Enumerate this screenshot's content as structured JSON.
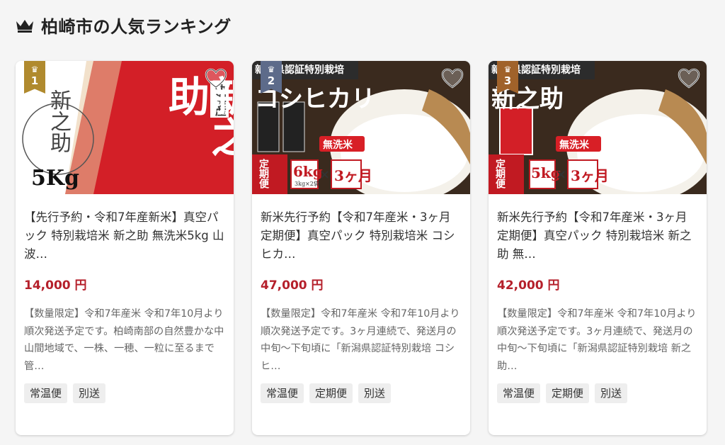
{
  "header": {
    "title": "柏崎市の人気ランキング",
    "icon": "crown-icon"
  },
  "colors": {
    "price": "#b5202b",
    "rank_badge": "#b08a2e",
    "tag_bg": "#eeeeee"
  },
  "cards": [
    {
      "rank": "1",
      "image_text": {
        "brand": "新之助",
        "weight": "5Kg",
        "seal": "新之助",
        "label": "新潟産"
      },
      "title": "【先行予約・令和7年産新米】真空パック 特別栽培米 新之助 無洗米5kg 山波…",
      "price": "14,000 円",
      "description": "【数量限定】令和7年産米 令和7年10月より順次発送予定です。柏崎南部の自然豊かな中山間地域で、一株、一穂、一粒に至るまで管…",
      "tags": [
        "常温便",
        "別送"
      ]
    },
    {
      "rank": "2",
      "image_text": {
        "banner": "新潟県認証特別栽培",
        "brand": "コシヒカリ",
        "wash": "無洗米",
        "teiki": "定期便",
        "amount": "6kg",
        "sub": "3kg×2袋",
        "times": "3ヶ月"
      },
      "title": "新米先行予約【令和7年産米・3ヶ月定期便】真空パック 特別栽培米 コシヒカ…",
      "price": "47,000 円",
      "description": "【数量限定】令和7年産米 令和7年10月より順次発送予定です。3ヶ月連続で、発送月の中旬～下旬頃に「新潟県認証特別栽培 コシヒ…",
      "tags": [
        "常温便",
        "定期便",
        "別送"
      ]
    },
    {
      "rank": "3",
      "image_text": {
        "banner": "新潟県認証特別栽培",
        "brand": "新之助",
        "wash": "無洗米",
        "teiki": "定期便",
        "amount": "5kg",
        "times": "3ヶ月"
      },
      "title": "新米先行予約【令和7年産米・3ヶ月定期便】真空パック 特別栽培米 新之助 無…",
      "price": "42,000 円",
      "description": "【数量限定】令和7年産米 令和7年10月より順次発送予定です。3ヶ月連続で、発送月の中旬～下旬頃に「新潟県認証特別栽培 新之助…",
      "tags": [
        "常温便",
        "定期便",
        "別送"
      ]
    }
  ]
}
